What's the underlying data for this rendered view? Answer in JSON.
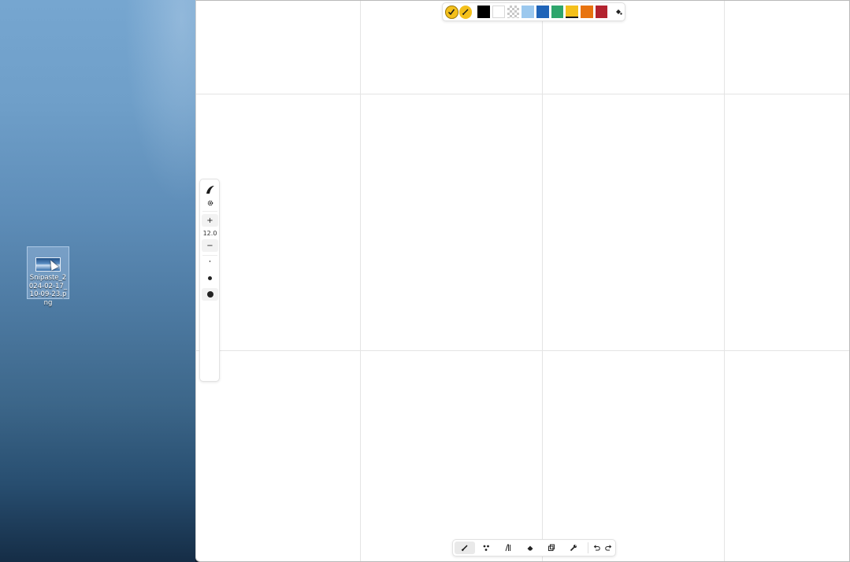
{
  "desktop": {
    "icon": {
      "name": "file-icon",
      "label": "Snipaste_2024-02-17_10-09-23.png"
    }
  },
  "palette": {
    "primary_color": "#F4C01B",
    "secondary_color": "#F4C01B",
    "swatches": [
      {
        "name": "black",
        "color": "#000000"
      },
      {
        "name": "white",
        "color": "#FFFFFF"
      },
      {
        "name": "transparent",
        "color": "transparent"
      },
      {
        "name": "light-blue",
        "color": "#9BC8EE"
      },
      {
        "name": "blue",
        "color": "#1F64B8"
      },
      {
        "name": "green",
        "color": "#2EA56C"
      },
      {
        "name": "yellow",
        "color": "#F4C01B"
      },
      {
        "name": "orange",
        "color": "#E8730E"
      },
      {
        "name": "red",
        "color": "#B3232F"
      }
    ],
    "fill_icon": "paint-bucket-icon"
  },
  "left_toolbar": {
    "brush_icon": "brush-icon",
    "settings_icon": "gear-icon",
    "zoom_in_label": "+",
    "zoom_value": "12.0",
    "zoom_out_label": "−",
    "sizes": [
      "small",
      "medium",
      "large"
    ]
  },
  "bottom_toolbar": {
    "tools": [
      {
        "name": "pen-tool",
        "icon": "pen-icon",
        "active": true
      },
      {
        "name": "shapes-tool",
        "icon": "shapes-icon",
        "active": false
      },
      {
        "name": "text-tool",
        "icon": "text-icon",
        "active": false
      },
      {
        "name": "eraser-tool",
        "icon": "eraser-icon",
        "active": false
      },
      {
        "name": "copy-tool",
        "icon": "copy-icon",
        "active": false
      },
      {
        "name": "settings-tool",
        "icon": "wrench-icon",
        "active": false
      }
    ],
    "undo_icon": "undo-icon",
    "redo_icon": "redo-icon"
  }
}
